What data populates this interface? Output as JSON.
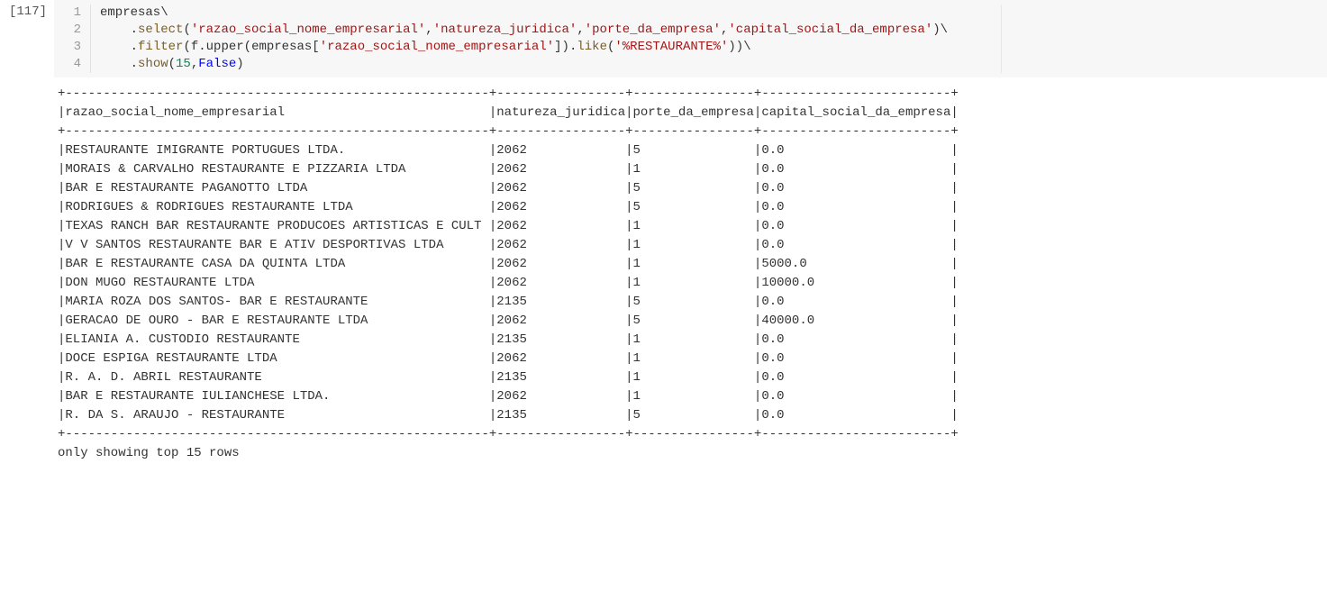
{
  "prompt": "[117]",
  "lineNumbers": [
    "1",
    "2",
    "3",
    "4"
  ],
  "code": {
    "l1": {
      "t1": "empresas\\"
    },
    "l2": {
      "indent": "    ",
      "dot": ".",
      "method": "select",
      "open": "(",
      "s1": "'razao_social_nome_empresarial'",
      "c1": ",",
      "s2": "'natureza_juridica'",
      "c2": ",",
      "s3": "'porte_da_empresa'",
      "c3": ",",
      "s4": "'capital_social_da_empresa'",
      "close": ")\\"
    },
    "l3": {
      "indent": "    ",
      "dot": ".",
      "method": "filter",
      "open": "(",
      "fupper": "f.upper",
      "open2": "(",
      "empresas": "empresas",
      "bracket_open": "[",
      "s1": "'razao_social_nome_empresarial'",
      "bracket_close": "]",
      "close2": ")",
      "dot2": ".",
      "like": "like",
      "open3": "(",
      "s2": "'%RESTAURANTE%'",
      "close3": "))\\"
    },
    "l4": {
      "indent": "    ",
      "dot": ".",
      "method": "show",
      "open": "(",
      "num": "15",
      "comma": ",",
      "kw": "False",
      "close": ")"
    }
  },
  "table": {
    "cols": [
      {
        "name": "razao_social_nome_empresarial",
        "width": 56
      },
      {
        "name": "natureza_juridica",
        "width": 17
      },
      {
        "name": "porte_da_empresa",
        "width": 16
      },
      {
        "name": "capital_social_da_empresa",
        "width": 25
      }
    ],
    "rows": [
      [
        "RESTAURANTE IMIGRANTE PORTUGUES LTDA.",
        "2062",
        "5",
        "0.0"
      ],
      [
        "MORAIS & CARVALHO RESTAURANTE E PIZZARIA LTDA",
        "2062",
        "1",
        "0.0"
      ],
      [
        "BAR E RESTAURANTE PAGANOTTO LTDA",
        "2062",
        "5",
        "0.0"
      ],
      [
        "RODRIGUES & RODRIGUES RESTAURANTE LTDA",
        "2062",
        "5",
        "0.0"
      ],
      [
        "TEXAS RANCH BAR RESTAURANTE PRODUCOES ARTISTICAS E CULT",
        "2062",
        "1",
        "0.0"
      ],
      [
        "V V SANTOS RESTAURANTE BAR E ATIV DESPORTIVAS LTDA",
        "2062",
        "1",
        "0.0"
      ],
      [
        "BAR E RESTAURANTE CASA DA QUINTA LTDA",
        "2062",
        "1",
        "5000.0"
      ],
      [
        "DON MUGO RESTAURANTE LTDA",
        "2062",
        "1",
        "10000.0"
      ],
      [
        "MARIA ROZA DOS SANTOS- BAR E RESTAURANTE",
        "2135",
        "5",
        "0.0"
      ],
      [
        "GERACAO DE OURO - BAR E RESTAURANTE LTDA",
        "2062",
        "5",
        "40000.0"
      ],
      [
        "ELIANIA A. CUSTODIO RESTAURANTE",
        "2135",
        "1",
        "0.0"
      ],
      [
        "DOCE ESPIGA RESTAURANTE LTDA",
        "2062",
        "1",
        "0.0"
      ],
      [
        "R. A. D. ABRIL RESTAURANTE",
        "2135",
        "1",
        "0.0"
      ],
      [
        "BAR E RESTAURANTE IULIANCHESE LTDA.",
        "2062",
        "1",
        "0.0"
      ],
      [
        "R. DA S. ARAUJO - RESTAURANTE",
        "2135",
        "5",
        "0.0"
      ]
    ],
    "footer": "only showing top 15 rows"
  }
}
